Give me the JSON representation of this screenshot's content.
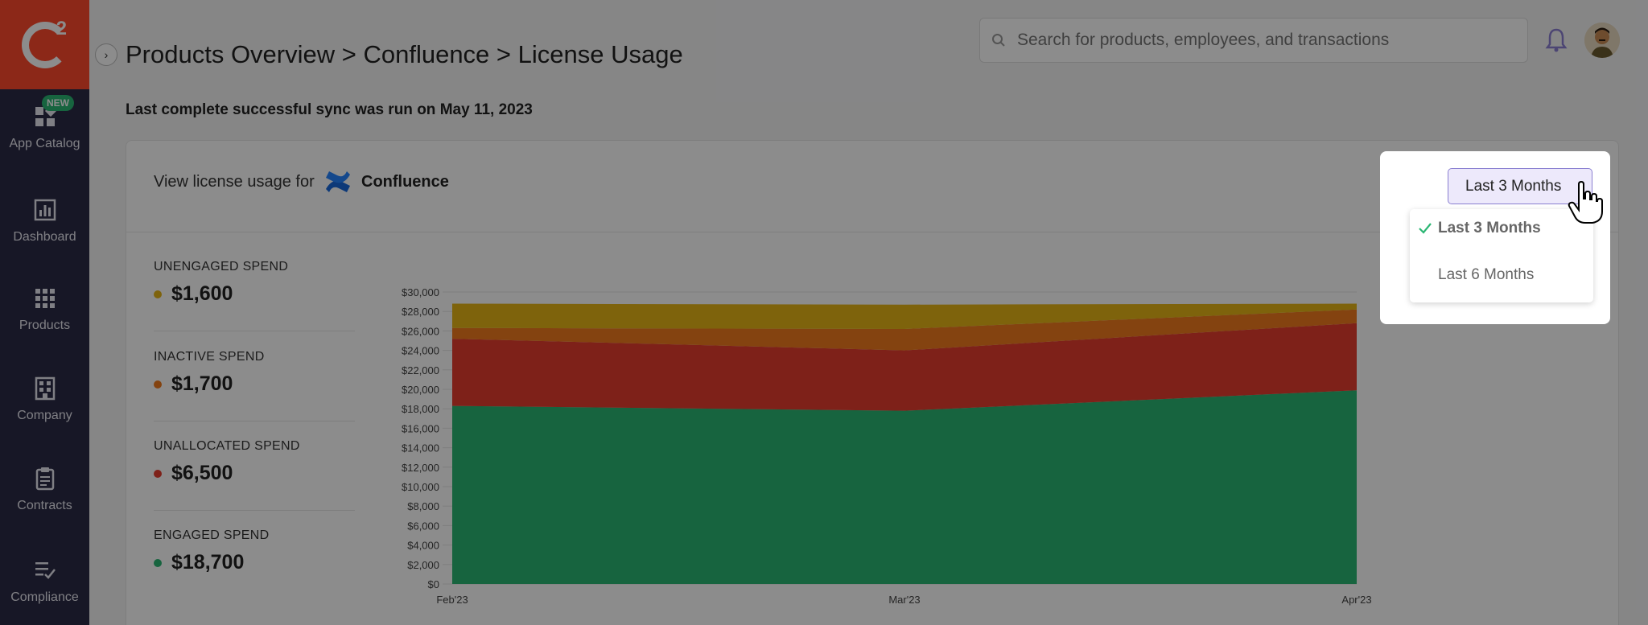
{
  "sidebar": {
    "items": [
      {
        "label": "App Catalog",
        "icon": "app-catalog-icon",
        "badge": "NEW"
      },
      {
        "label": "Dashboard",
        "icon": "dashboard-icon"
      },
      {
        "label": "Products",
        "icon": "products-icon"
      },
      {
        "label": "Company",
        "icon": "company-icon"
      },
      {
        "label": "Contracts",
        "icon": "contracts-icon"
      },
      {
        "label": "Compliance",
        "icon": "compliance-icon"
      }
    ]
  },
  "header": {
    "breadcrumb": "Products Overview > Confluence > License Usage",
    "search_placeholder": "Search for products, employees, and transactions"
  },
  "sync_text": "Last complete successful sync was run on May 11, 2023",
  "card": {
    "view_label": "View license usage for",
    "product_name": "Confluence"
  },
  "stats": [
    {
      "label": "UNENGAGED SPEND",
      "value": "$1,600",
      "color": "#e6b416"
    },
    {
      "label": "INACTIVE SPEND",
      "value": "$1,700",
      "color": "#f07a1e"
    },
    {
      "label": "UNALLOCATED SPEND",
      "value": "$6,500",
      "color": "#e63c2e"
    },
    {
      "label": "ENGAGED SPEND",
      "value": "$18,700",
      "color": "#2bb673"
    }
  ],
  "period": {
    "selected": "Last 3 Months",
    "options": [
      "Last 3 Months",
      "Last 6 Months"
    ]
  },
  "chart_data": {
    "type": "area",
    "stacked": true,
    "categories": [
      "Feb'23",
      "Mar'23",
      "Apr'23"
    ],
    "y_ticks": [
      "$0",
      "$2,000",
      "$4,000",
      "$6,000",
      "$8,000",
      "$10,000",
      "$12,000",
      "$14,000",
      "$16,000",
      "$18,000",
      "$20,000",
      "$22,000",
      "$24,000",
      "$26,000",
      "$28,000",
      "$30,000"
    ],
    "ylim": [
      0,
      30000
    ],
    "series": [
      {
        "values": [
          18300,
          17800,
          19900
        ],
        "color": "#2bb673"
      },
      {
        "values": [
          6900,
          6200,
          6900
        ],
        "color": "#e63c2e"
      },
      {
        "values": [
          1100,
          2200,
          1400
        ],
        "color": "#f07a1e"
      },
      {
        "values": [
          2500,
          2500,
          600
        ],
        "color": "#e6b416"
      }
    ]
  }
}
